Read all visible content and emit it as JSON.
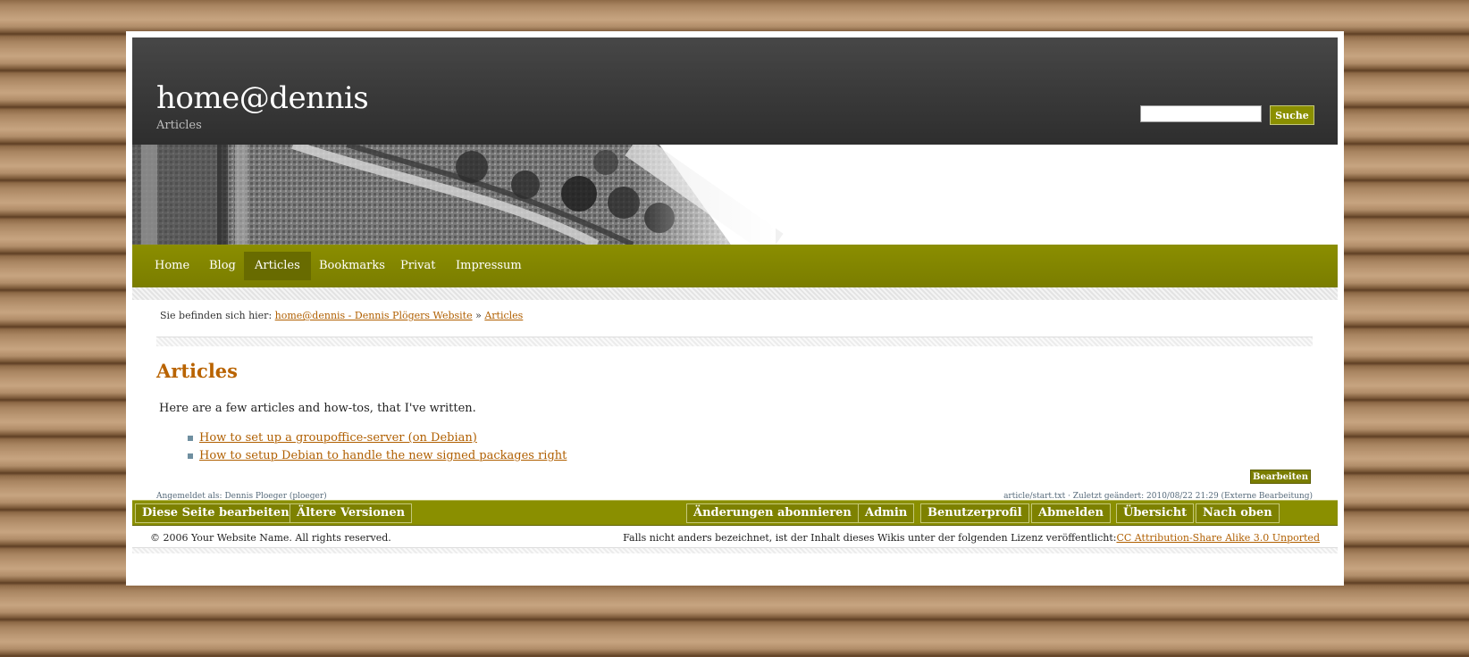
{
  "header": {
    "site_title": "home@dennis",
    "subtitle": "Articles",
    "search": {
      "placeholder": "",
      "value": "",
      "button_label": "Suche"
    }
  },
  "nav": {
    "items": [
      {
        "label": "Home",
        "active": false
      },
      {
        "label": "Blog",
        "active": false
      },
      {
        "label": "Articles",
        "active": true
      },
      {
        "label": "Bookmarks",
        "active": false
      },
      {
        "label": "Privat",
        "active": false
      },
      {
        "label": "Impressum",
        "active": false
      }
    ]
  },
  "breadcrumb": {
    "prefix": "Sie befinden sich hier:",
    "items": [
      {
        "label": "home@dennis - Dennis Plögers Website"
      },
      {
        "label": "Articles"
      }
    ],
    "separator": "»"
  },
  "content": {
    "heading": "Articles",
    "intro": "Here are a few articles and how-tos, that I've written.",
    "articles": [
      {
        "label": "How to set up a groupoffice-server (on Debian)"
      },
      {
        "label": "How to setup Debian to handle the new signed packages right"
      }
    ],
    "edit_button": "Bearbeiten"
  },
  "meta": {
    "logged_in": "Angemeldet als: Dennis Ploeger (ploeger)",
    "page_info": "article/start.txt · Zuletzt geändert: 2010/08/22 21:29 (Externe Bearbeitung)"
  },
  "toolbar": {
    "left": [
      {
        "label": "Diese Seite bearbeiten"
      },
      {
        "label": "Ältere Versionen"
      }
    ],
    "right": [
      {
        "label": "Änderungen abonnieren"
      },
      {
        "label": "Admin"
      },
      {
        "label": "Benutzerprofil"
      },
      {
        "label": "Abmelden"
      },
      {
        "label": "Übersicht"
      },
      {
        "label": "Nach oben"
      }
    ]
  },
  "footer": {
    "copyright": "© 2006 Your Website Name. All rights reserved.",
    "license_text": "Falls nicht anders bezeichnet, ist der Inhalt dieses Wikis unter der folgenden Lizenz veröffentlicht:",
    "license_link": "CC Attribution-Share Alike 3.0 Unported"
  },
  "colors": {
    "accent_olive": "#7a7d00",
    "link_orange": "#b05f00",
    "header_dark": "#3a3a3a"
  }
}
